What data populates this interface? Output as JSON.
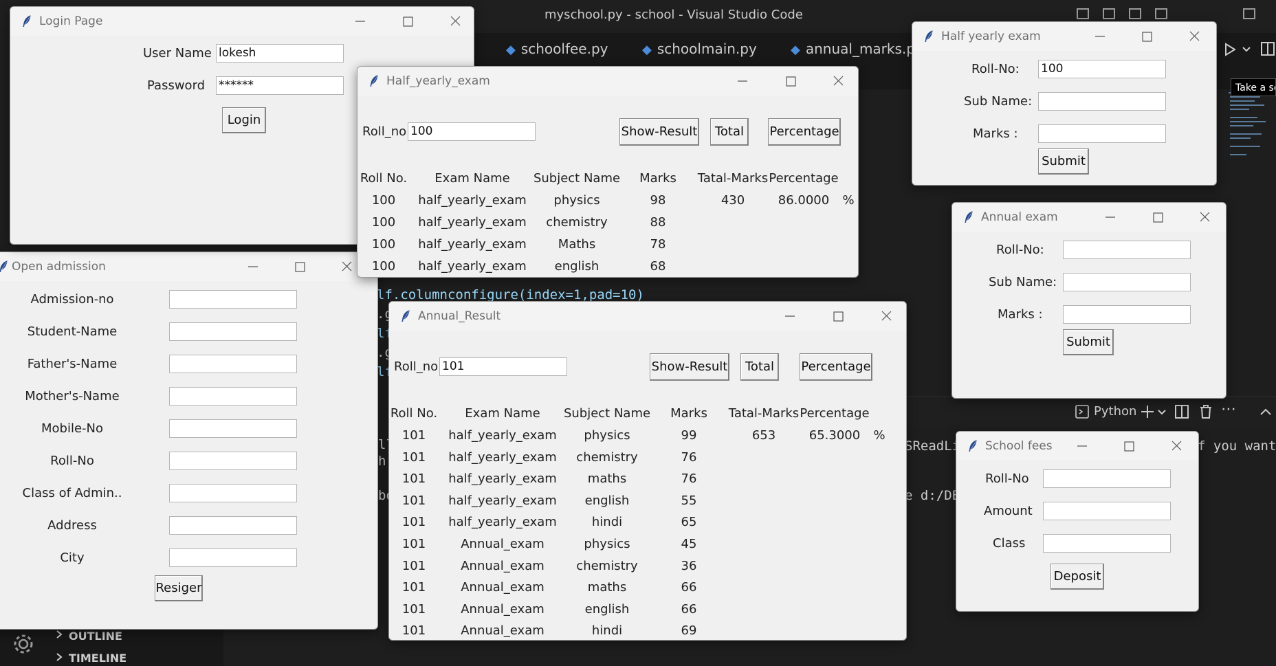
{
  "vscode": {
    "title": "myschool.py - school - Visual Studio Code",
    "tabs": [
      {
        "label": "schoolfee.py"
      },
      {
        "label": "schoolmain.py"
      },
      {
        "label": "annual_marks.py"
      }
    ],
    "code_lines": [
      "lf.columnconfigure(index=1,pad=10)",
      ".g",
      "lf",
      ".g",
      "lf"
    ],
    "terminal": {
      "profile": "Python",
      "line1_left": "SReadLi",
      "line1_right": "f you want",
      "line2": "e d:/DE"
    },
    "left_code": [
      "ll",
      "h",
      "bo"
    ],
    "sidebar": {
      "outline": "OUTLINE",
      "timeline": "TIMELINE"
    },
    "tooltip": "Take a sc"
  },
  "login": {
    "title": "Login Page",
    "username_label": "User Name",
    "username_value": "lokesh",
    "password_label": "Password",
    "password_value": "******",
    "login_button": "Login"
  },
  "half_yearly_exam_window": {
    "title": "Half_yearly_exam",
    "rollno_label": "Roll_no",
    "rollno_value": "100",
    "buttons": {
      "show": "Show-Result",
      "total": "Total",
      "percentage": "Percentage"
    },
    "headers": [
      "Roll No.",
      "Exam Name",
      "Subject Name",
      "Marks",
      "Tatal-Marks",
      "Percentage"
    ],
    "rows": [
      [
        "100",
        "half_yearly_exam",
        "physics",
        "98"
      ],
      [
        "100",
        "half_yearly_exam",
        "chemistry",
        "88"
      ],
      [
        "100",
        "half_yearly_exam",
        "Maths",
        "78"
      ],
      [
        "100",
        "half_yearly_exam",
        "english",
        "68"
      ]
    ],
    "total_marks": "430",
    "percentage": "86.0000",
    "percent_sign": "%"
  },
  "annual_result": {
    "title": "Annual_Result",
    "rollno_label": "Roll_no",
    "rollno_value": "101",
    "buttons": {
      "show": "Show-Result",
      "total": "Total",
      "percentage": "Percentage"
    },
    "headers": [
      "Roll No.",
      "Exam Name",
      "Subject Name",
      "Marks",
      "Tatal-Marks",
      "Percentage"
    ],
    "rows": [
      [
        "101",
        "half_yearly_exam",
        "physics",
        "99"
      ],
      [
        "101",
        "half_yearly_exam",
        "chemistry",
        "76"
      ],
      [
        "101",
        "half_yearly_exam",
        "maths",
        "76"
      ],
      [
        "101",
        "half_yearly_exam",
        "english",
        "55"
      ],
      [
        "101",
        "half_yearly_exam",
        "hindi",
        "65"
      ],
      [
        "101",
        "Annual_exam",
        "physics",
        "45"
      ],
      [
        "101",
        "Annual_exam",
        "chemistry",
        "36"
      ],
      [
        "101",
        "Annual_exam",
        "maths",
        "66"
      ],
      [
        "101",
        "Annual_exam",
        "english",
        "66"
      ],
      [
        "101",
        "Annual_exam",
        "hindi",
        "69"
      ]
    ],
    "total_marks": "653",
    "percentage": "65.3000",
    "percent_sign": "%"
  },
  "half_yearly_entry": {
    "title": "Half yearly exam",
    "roll_label": "Roll-No:",
    "roll_value": "100",
    "sub_label": "Sub Name:",
    "marks_label": "Marks  :",
    "submit": "Submit"
  },
  "annual_entry": {
    "title": "Annual exam",
    "roll_label": "Roll-No:",
    "sub_label": "Sub Name:",
    "marks_label": "Marks  :",
    "submit": "Submit"
  },
  "admission": {
    "title": "Open admission",
    "fields": [
      "Admission-no",
      "Student-Name",
      "Father's-Name",
      "Mother's-Name",
      "Mobile-No",
      "Roll-No",
      "Class of Admin..",
      "Address",
      "City"
    ],
    "register_button": "Resiger"
  },
  "fees": {
    "title": "School fees",
    "roll_label": "Roll-No",
    "amount_label": "Amount",
    "class_label": "Class",
    "deposit_button": "Deposit"
  }
}
